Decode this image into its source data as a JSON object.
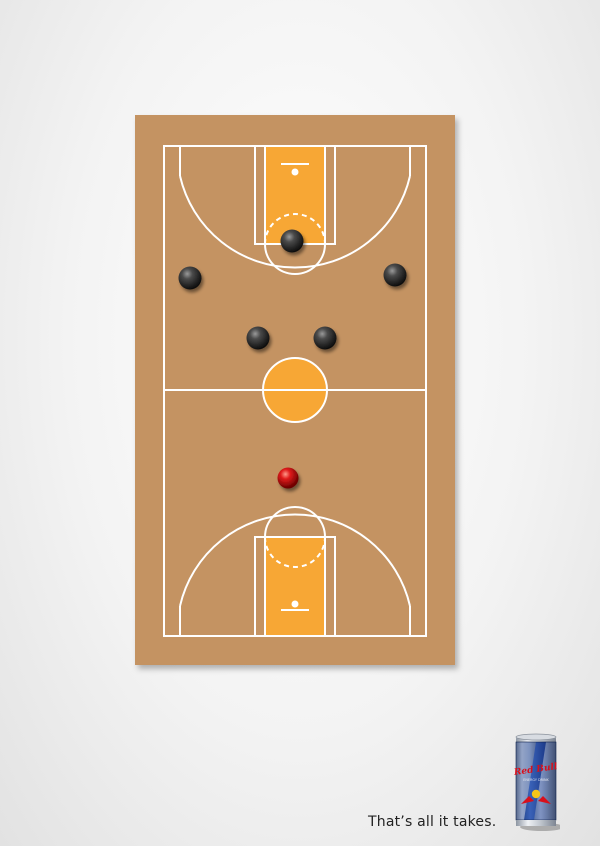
{
  "tagline": "That’s all it takes.",
  "can": {
    "brand": "Red Bull",
    "sub_label": "ENERGY DRINK"
  },
  "colors": {
    "page_background": "#f1f1f1",
    "court_wood": "#c49362",
    "key_paint": "#f7a735",
    "court_lines": "#ffffff",
    "defender_piece": "#3a3a3a",
    "attacker_piece": "#cc1111",
    "can_blue": "#1f3f8f",
    "can_silver": "#c7ccd3",
    "brand_red": "#d8101c",
    "brand_yellow": "#f5c61a"
  },
  "pieces": {
    "defenders": 5,
    "attackers": 1
  }
}
